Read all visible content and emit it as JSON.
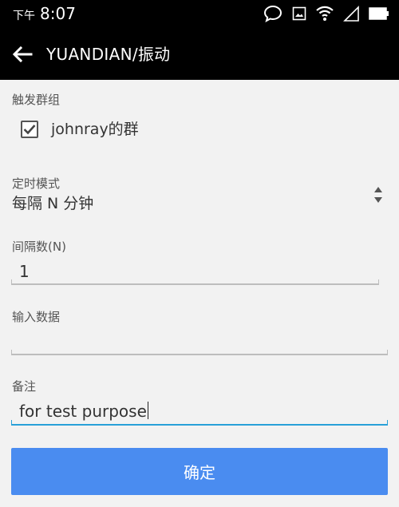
{
  "status_bar": {
    "ampm": "下午",
    "time": "8:07",
    "icons": [
      "chat-bubble-icon",
      "image-icon",
      "wifi-icon",
      "cellular-signal-icon",
      "battery-icon"
    ]
  },
  "app_bar": {
    "back_icon": "arrow-left-icon",
    "title": "YUANDIAN/振动"
  },
  "form": {
    "trigger_group": {
      "label": "触发群组",
      "checkbox_label": "johnray的群",
      "checked": true
    },
    "schedule_mode": {
      "label": "定时模式",
      "value": "每隔 N 分钟"
    },
    "interval": {
      "label": "间隔数(N)",
      "value": "1"
    },
    "input_data": {
      "label": "输入数据",
      "value": ""
    },
    "remark": {
      "label": "备注",
      "value": "for test purpose"
    },
    "confirm_label": "确定"
  },
  "colors": {
    "status_bar_bg": "#000000",
    "app_bar_bg": "#000000",
    "page_bg": "#f2f2f2",
    "primary_button": "#4a8cf0",
    "active_underline": "#29a0d8",
    "inactive_underline": "#bdbdbd"
  }
}
